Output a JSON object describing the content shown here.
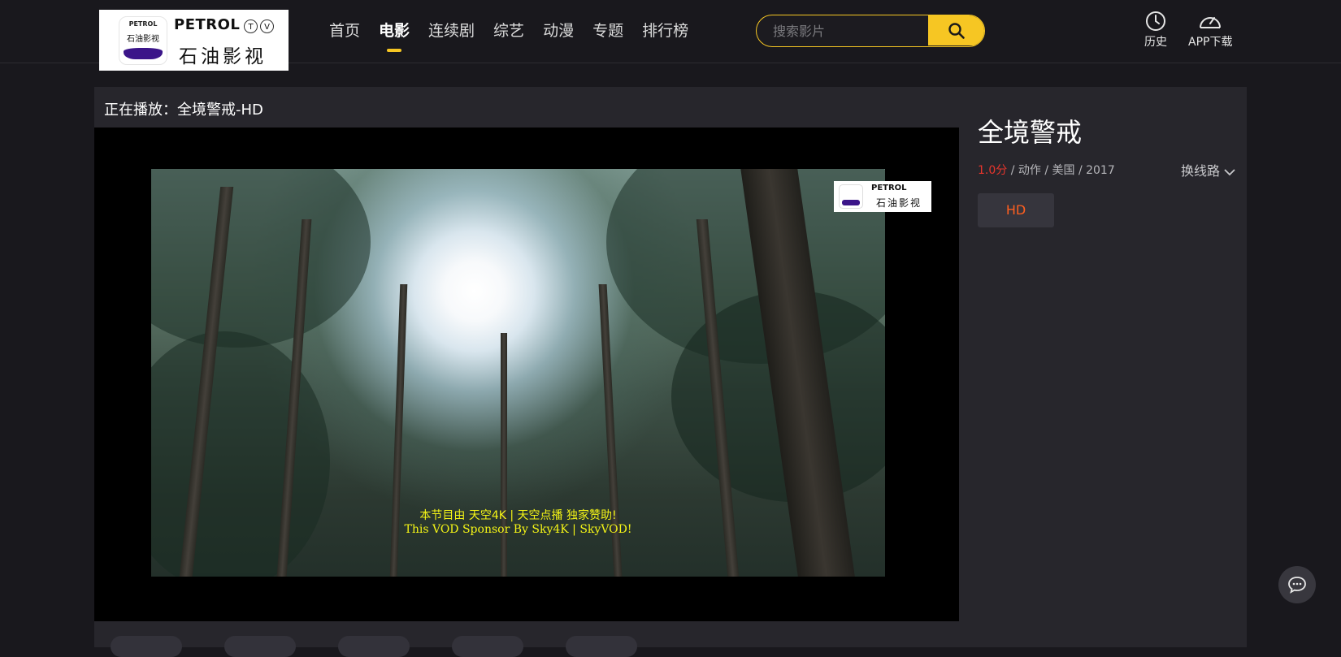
{
  "brand": {
    "logo_en": "PETROL",
    "logo_tv": [
      "T",
      "V"
    ],
    "logo_cn": "石油影视",
    "emblem_top": "PETROL",
    "emblem_cn": "石油影视",
    "accent": "#f6c623",
    "emblem_color": "#3b1589"
  },
  "nav": {
    "items": [
      {
        "label": "首页"
      },
      {
        "label": "电影",
        "active": true
      },
      {
        "label": "连续剧"
      },
      {
        "label": "综艺"
      },
      {
        "label": "动漫"
      },
      {
        "label": "专题"
      },
      {
        "label": "排行榜"
      }
    ]
  },
  "search": {
    "placeholder": "搜索影片",
    "value": "",
    "icon": "search-icon"
  },
  "header_tools": {
    "history_label": "历史",
    "history_icon": "clock-icon",
    "app_label": "APP下载",
    "app_icon": "speedometer-icon"
  },
  "player": {
    "now_playing": "正在播放：全境警戒-HD",
    "subtitle_cn": "本节目由 天空4K | 天空点播 独家赞助!",
    "subtitle_en": "This VOD Sponsor By Sky4K | SkyVOD!",
    "watermark_en": "PETROL",
    "watermark_cn": "石油影视"
  },
  "info": {
    "title": "全境警戒",
    "score": "1.0分",
    "meta_rest": " / 动作 / 美国 / 2017",
    "switch_line": "换线路",
    "episode_label": "HD",
    "score_color": "#e8352c",
    "episode_color": "#ff5f1f"
  },
  "chat": {
    "icon": "chat-bubble-icon"
  }
}
